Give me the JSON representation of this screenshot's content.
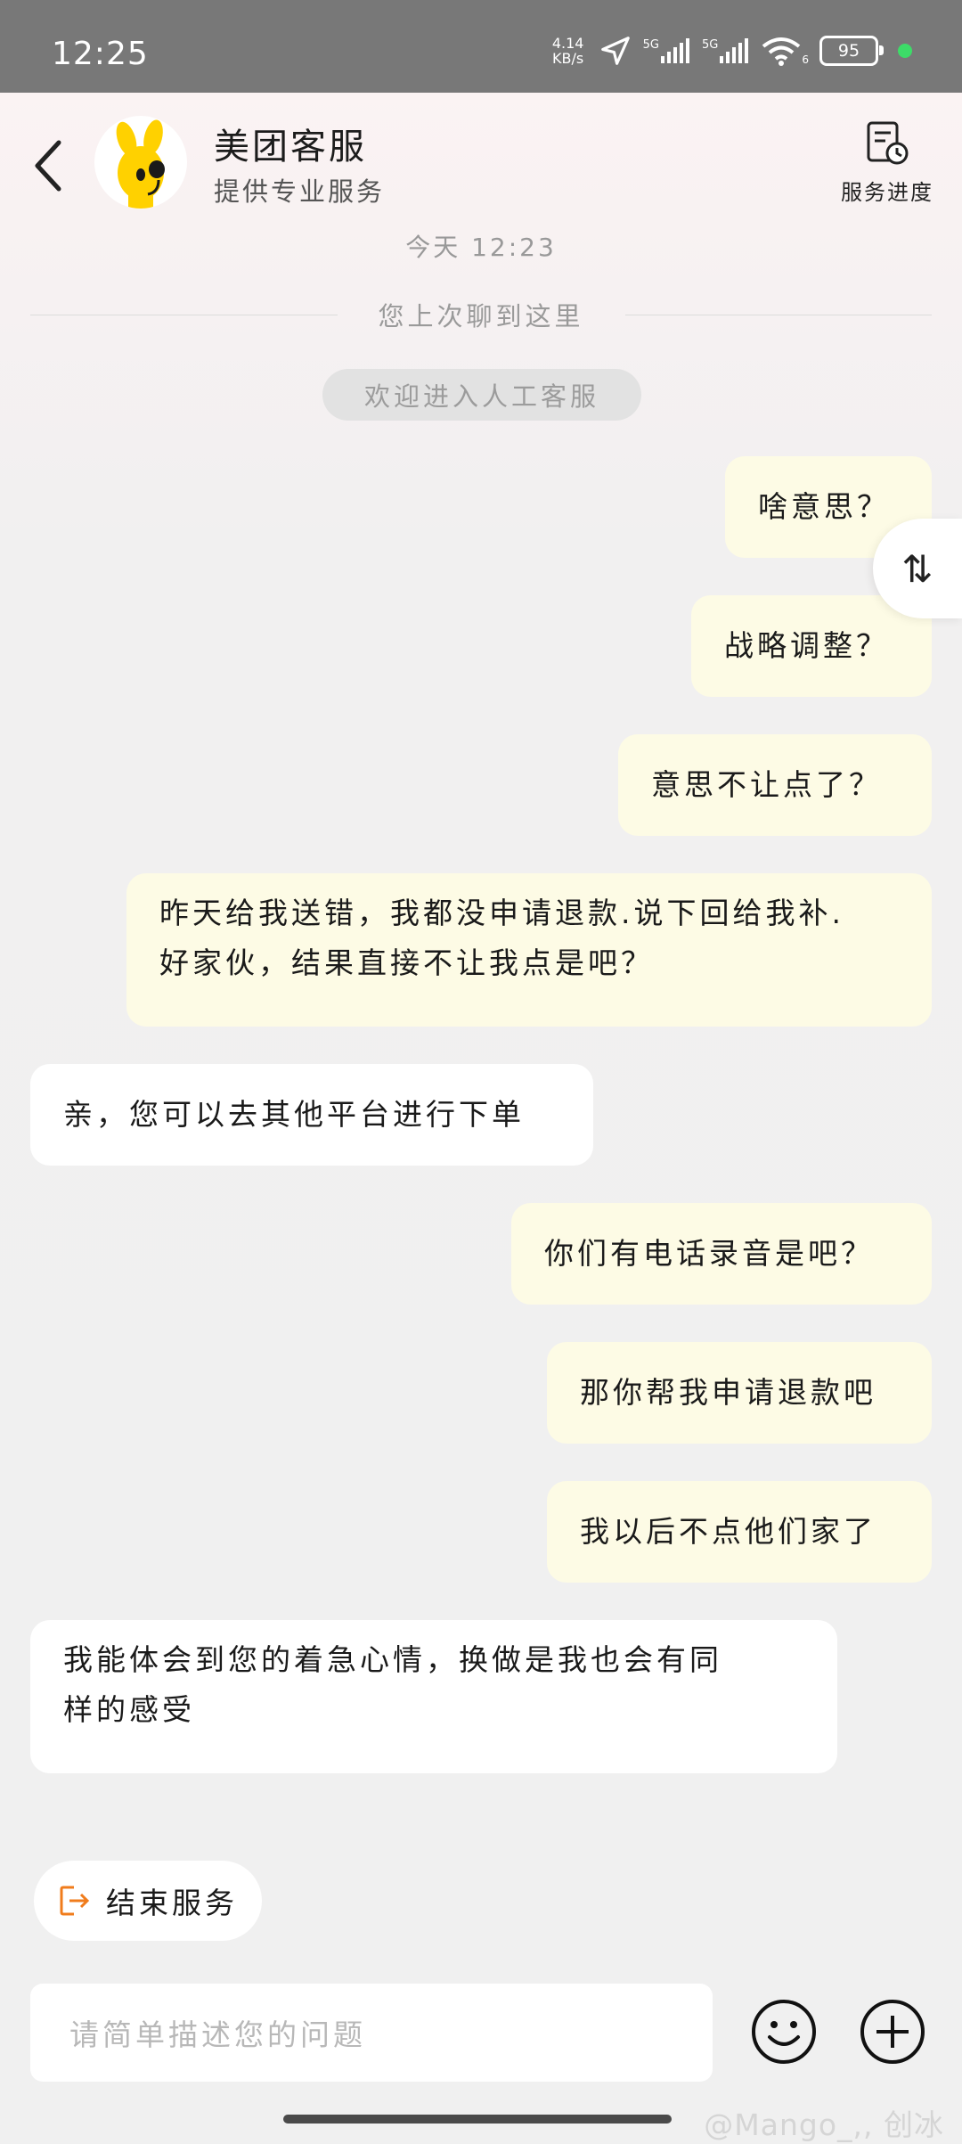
{
  "status_bar": {
    "time": "12:25",
    "net_speed_value": "4.14",
    "net_speed_unit": "KB/s",
    "signal1_label": "5G",
    "signal2_label": "5G",
    "wifi_badge": "6",
    "battery": "95"
  },
  "header": {
    "title": "美团客服",
    "subtitle": "提供专业服务",
    "progress_label": "服务进度"
  },
  "chat": {
    "time_label": "今天 12:23",
    "divider_text": "您上次聊到这里",
    "system_notice": "欢迎进入人工客服",
    "messages": [
      {
        "from": "me",
        "text": "啥意思？"
      },
      {
        "from": "me",
        "text": "战略调整？"
      },
      {
        "from": "me",
        "text": "意思不让点了？"
      },
      {
        "from": "me",
        "line1": "昨天给我送错，我都没申请退款.说下回给我补.",
        "line2": "好家伙，结果直接不让我点是吧？"
      },
      {
        "from": "them",
        "text": "亲，您可以去其他平台进行下单"
      },
      {
        "from": "me",
        "text": "你们有电话录音是吧？"
      },
      {
        "from": "me",
        "text": "那你帮我申请退款吧"
      },
      {
        "from": "me",
        "text": "我以后不点他们家了"
      },
      {
        "from": "them",
        "line1": "我能体会到您的着急心情，换做是我也会有同",
        "line2": "样的感受"
      }
    ]
  },
  "toggle_icon": "⇅",
  "end_service_label": "结束服务",
  "input": {
    "placeholder": "请简单描述您的问题"
  },
  "watermark": "@Mango_,, 创冰",
  "colors": {
    "my_bubble": "#fdfbe5",
    "their_bubble": "#ffffff",
    "end_icon": "#f07c1c",
    "status_bar": "#787878"
  },
  "icons": [
    "back-icon",
    "mascot-avatar",
    "service-progress-icon",
    "sort-toggle-icon",
    "exit-icon",
    "emoji-icon",
    "plus-icon"
  ]
}
